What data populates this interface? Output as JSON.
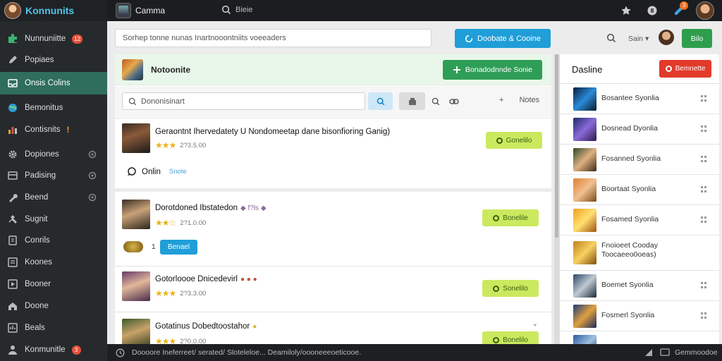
{
  "sidebar": {
    "brand": "Konnunits",
    "items": [
      {
        "label": "Nunnuniitte",
        "icon": "puzzle-icon",
        "badge": "12"
      },
      {
        "label": "Popiaes",
        "icon": "pencil-icon"
      },
      {
        "label": "Onsis Colins",
        "icon": "inbox-icon",
        "active": true
      },
      {
        "label": "Bemonitus",
        "icon": "globe-icon"
      },
      {
        "label": "Contisnits",
        "icon": "chart-icon",
        "mark": "!"
      },
      {
        "label": "Dopiones",
        "icon": "gear-icon"
      },
      {
        "label": "Padising",
        "icon": "cart-icon"
      },
      {
        "label": "Beend",
        "icon": "wrench-icon"
      },
      {
        "label": "Sugnit",
        "icon": "tools-icon"
      },
      {
        "label": "Conrils",
        "icon": "document-icon"
      },
      {
        "label": "Koones",
        "icon": "list-icon"
      },
      {
        "label": "Booner",
        "icon": "play-icon"
      },
      {
        "label": "Doone",
        "icon": "home-icon"
      },
      {
        "label": "Beals",
        "icon": "message-icon"
      },
      {
        "label": "Konmunitle",
        "icon": "user-icon",
        "badge": "3"
      }
    ]
  },
  "topbar": {
    "app_title": "Camma",
    "search_placeholder": "Bieie",
    "notification_count": "3"
  },
  "toolbar": {
    "search_placeholder": "Sorhep tonne nunas  Inartnooontniits voeeaders",
    "create_label": "Doobate & Cooine",
    "right_label": "Sain",
    "right_button": "Bilo"
  },
  "feed": {
    "title": "Notoonite",
    "new_post_label": "Bonadodnnde Sonie",
    "filter_placeholder": "Dononisinart",
    "notes_label": "Notes",
    "posts": [
      {
        "title": "Geraontnt Ihervedatety  U Nondomeetap dane bisonfioring Ganig)",
        "stars": "★★★",
        "meta": "2?3.5.00",
        "action": "Gonelilo",
        "extra_label": "Onlin",
        "extra_link": "Snote"
      },
      {
        "title": "Dorotdoned Ibstatedon",
        "stars": "★★☆",
        "meta": "2?1.0.00",
        "action": "Bonelile",
        "emoji": "◆ f?ls ◆",
        "tag_label": "1",
        "tag_button": "Benael"
      },
      {
        "title": "Gotorloooe Dnicedevirl",
        "stars": "★★★",
        "meta": "2?3.3.00",
        "action": "Sonelilo",
        "emoji": "● ● ●"
      },
      {
        "title": "Gotatinus  Dobedtoostahor",
        "stars": "★★★",
        "meta": "2?0.0.00",
        "action": "Bonelilo",
        "emoji": "●"
      }
    ]
  },
  "rpanel": {
    "title": "Dasline",
    "button_label": "Bemnette",
    "items": [
      {
        "title": "Bosantee Syonlia"
      },
      {
        "title": "Dosnead Dyonlia"
      },
      {
        "title": "Fosanned Syonlia"
      },
      {
        "title": "Boortaat Syonlia"
      },
      {
        "title": "Fosamed Syonlia"
      },
      {
        "title": "Fnoioeet Cooday",
        "subtitle": "Toocaeeo0oeas)"
      },
      {
        "title": "Boemet Syonlia"
      },
      {
        "title": "Fosmerl Syonlia"
      }
    ]
  },
  "status": {
    "text": "Doooore Ineferreet/ serated/  Sloteleloe...  Deamiloly/oooneeeoeticooe.",
    "right": "Gemmoodoe"
  },
  "colors": {
    "sidebar_bg": "#262a2d",
    "active_item": "#2f6e5b",
    "primary_blue": "#1f9ed8",
    "primary_green": "#2e9e57",
    "lime": "#cbe95e",
    "danger": "#e23a2a"
  }
}
